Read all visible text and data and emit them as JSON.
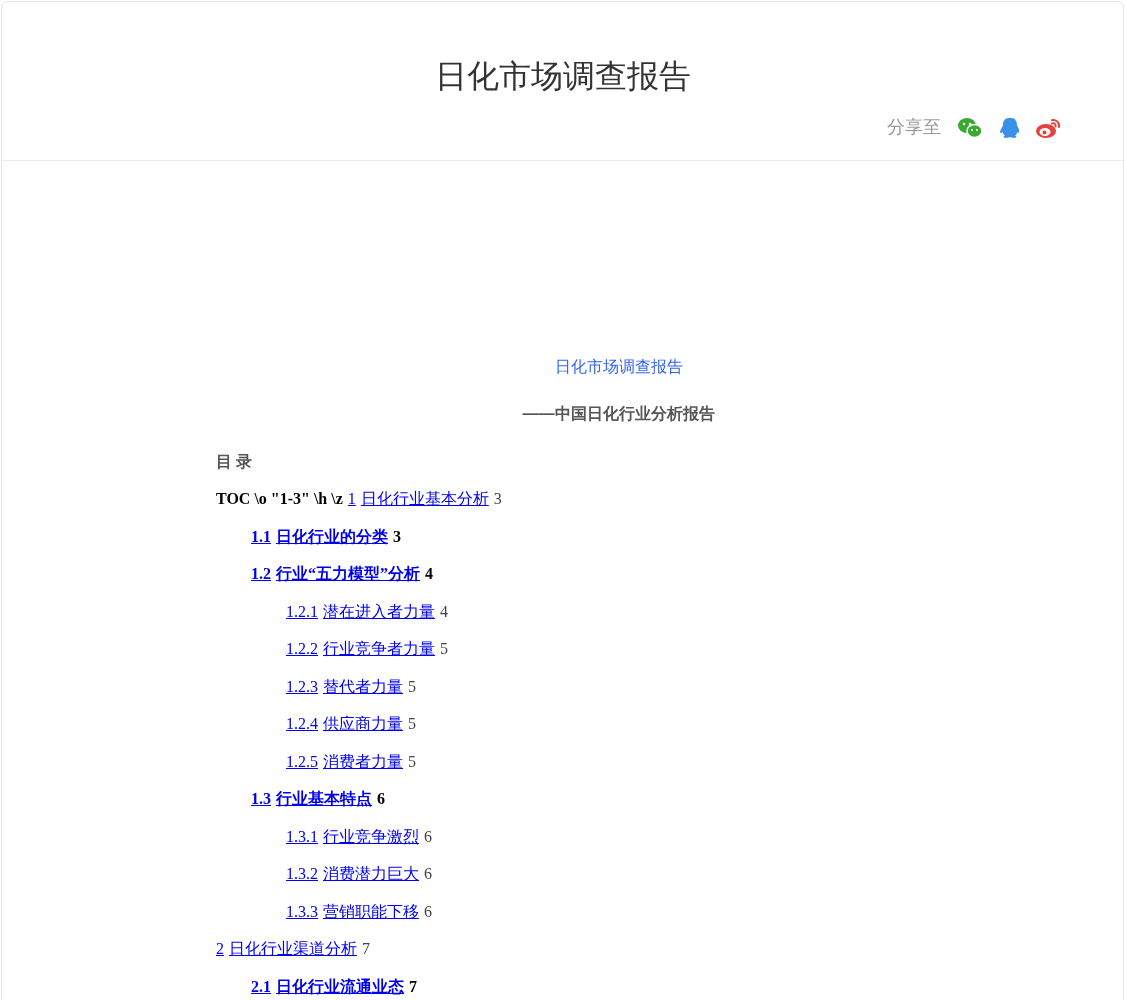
{
  "header": {
    "title": "日化市场调查报告",
    "share_label": "分享至"
  },
  "document": {
    "title": "日化市场调查报告",
    "subtitle": "——中国日化行业分析报告",
    "toc_heading": "目 录",
    "toc": [
      {
        "prefix": "TOC \\o \"1-3\" \\h \\z",
        "number": "1",
        "title": "日化行业基本分析",
        "page": "3",
        "children": [
          {
            "number": "1.1",
            "title": "日化行业的分类",
            "page": "3"
          },
          {
            "number": "1.2",
            "title": "行业“五力模型”分析",
            "page": "4",
            "children": [
              {
                "number": "1.2.1",
                "title": "潜在进入者力量",
                "page": "4"
              },
              {
                "number": "1.2.2",
                "title": "行业竞争者力量",
                "page": "5"
              },
              {
                "number": "1.2.3",
                "title": "替代者力量",
                "page": "5"
              },
              {
                "number": "1.2.4",
                "title": "供应商力量",
                "page": "5"
              },
              {
                "number": "1.2.5",
                "title": "消费者力量",
                "page": "5"
              }
            ]
          },
          {
            "number": "1.3",
            "title": "行业基本特点",
            "page": "6",
            "children": [
              {
                "number": "1.3.1",
                "title": "行业竞争激烈",
                "page": "6"
              },
              {
                "number": "1.3.2",
                "title": "消费潜力巨大",
                "page": "6"
              },
              {
                "number": "1.3.3",
                "title": "营销职能下移",
                "page": "6"
              }
            ]
          }
        ]
      },
      {
        "number": "2",
        "title": "日化行业渠道分析",
        "page": "7",
        "children": [
          {
            "number": "2.1",
            "title": "日化行业流通业态",
            "page": "7"
          }
        ]
      }
    ]
  }
}
